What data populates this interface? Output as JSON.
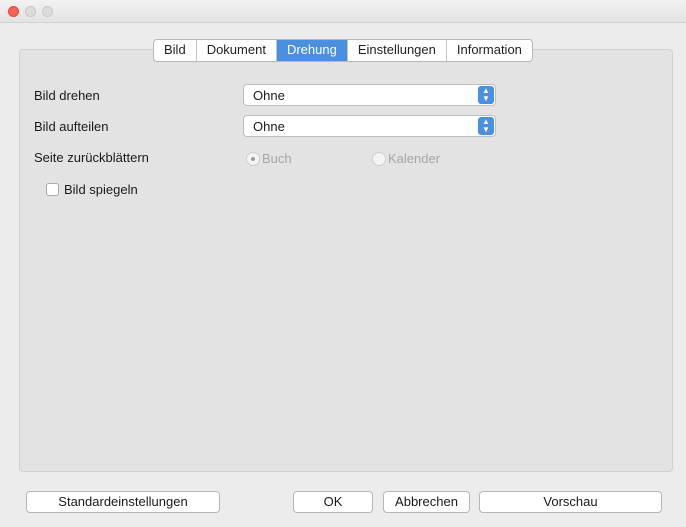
{
  "tabs": [
    {
      "label": "Bild",
      "active": false
    },
    {
      "label": "Dokument",
      "active": false
    },
    {
      "label": "Drehung",
      "active": true
    },
    {
      "label": "Einstellungen",
      "active": false
    },
    {
      "label": "Information",
      "active": false
    }
  ],
  "rotate": {
    "label": "Bild drehen",
    "value": "Ohne"
  },
  "split": {
    "label": "Bild aufteilen",
    "value": "Ohne"
  },
  "page_flip": {
    "label": "Seite zurückblättern",
    "options": [
      {
        "label": "Buch",
        "selected": true,
        "enabled": false
      },
      {
        "label": "Kalender",
        "selected": false,
        "enabled": false
      }
    ]
  },
  "mirror": {
    "label": "Bild spiegeln",
    "checked": false
  },
  "buttons": {
    "defaults": "Standardeinstellungen",
    "ok": "OK",
    "cancel": "Abbrechen",
    "preview": "Vorschau"
  },
  "colors": {
    "accent": "#4a90e2",
    "close": "#ff5f57"
  }
}
